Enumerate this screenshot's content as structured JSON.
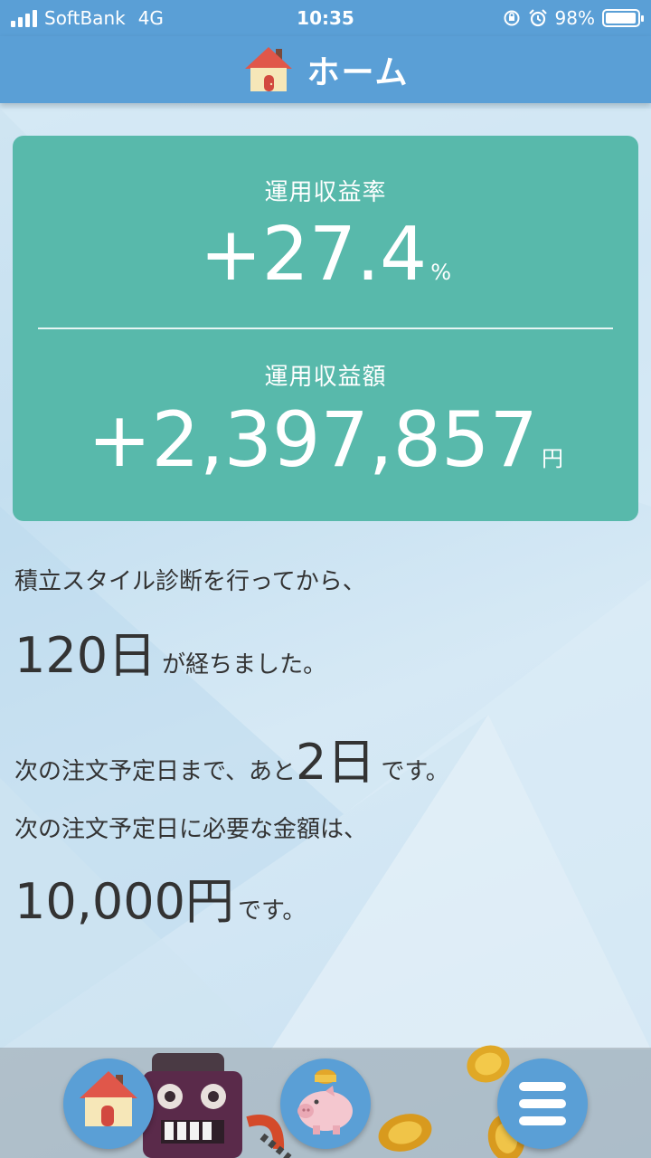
{
  "status_bar": {
    "carrier": "SoftBank",
    "network": "4G",
    "time": "10:35",
    "battery": "98%",
    "battery_level": 0.98
  },
  "header": {
    "title": "ホーム",
    "icon": "house-icon"
  },
  "summary_card": {
    "rate_label": "運用収益率",
    "rate_value": "+27.4",
    "rate_unit": "%",
    "amount_label": "運用収益額",
    "amount_value": "+2,397,857",
    "amount_unit": "円",
    "color": "#58b9ab"
  },
  "diagnosis": {
    "intro": "積立スタイル診断を行ってから、",
    "days": "120",
    "days_unit": "日",
    "suffix": "が経ちました。"
  },
  "next_order": {
    "prefix": "次の注文予定日まで、あと",
    "days": "2",
    "days_unit": "日",
    "suffix": "です。"
  },
  "required_amount": {
    "intro": "次の注文予定日に必要な金額は、",
    "amount": "10,000",
    "unit": "円",
    "suffix": "です。"
  },
  "tab_bar": {
    "home_icon": "house-icon",
    "savings_icon": "piggy-bank-icon",
    "menu_icon": "hamburger-menu-icon"
  },
  "colors": {
    "header": "#5a9fd6",
    "card": "#58b9ab"
  }
}
